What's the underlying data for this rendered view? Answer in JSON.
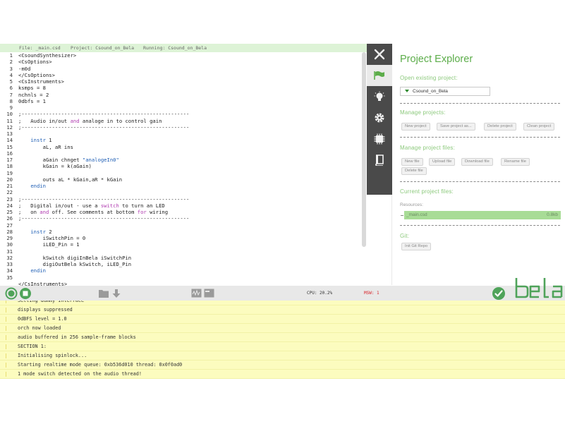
{
  "header": {
    "file": "File: _main.csd",
    "project": "Project: Csound_on_Bela",
    "running": "Running: Csound_on_Bela"
  },
  "editor": {
    "line_numbers": [
      "1",
      "2",
      "3",
      "4",
      "5",
      "6",
      "7",
      "8",
      "9",
      "10",
      "11",
      "12",
      "13",
      "14",
      "15",
      "16",
      "17",
      "18",
      "19",
      "20",
      "21",
      "22",
      "23",
      "24",
      "25",
      "26",
      "27",
      "28",
      "29",
      "30",
      "31",
      "32",
      "33",
      "34",
      "35"
    ],
    "lines": [
      "<CsoundSynthesizer>",
      "<CsOptions>",
      "-m0d",
      "</CsOptions>",
      "<CsInstruments>",
      "ksmps = 8",
      "nchnls = 2",
      "0dbfs = 1",
      "",
      ";-------------------------------------------------------",
      ";   Audio in/out and analoge in to control gain",
      ";-------------------------------------------------------",
      "",
      "    instr 1",
      "        aL, aR ins",
      "",
      "        aGain chnget \"analogeIn0\"",
      "        kGain = k(aGain)",
      "",
      "        outs aL * kGain,aR * kGain",
      "    endin",
      "",
      ";-------------------------------------------------------",
      ";   Digital in/out - use a switch to turn an LED",
      ";   on and off. See comments at bottom for wiring",
      ";-------------------------------------------------------",
      "",
      "    instr 2",
      "        iSwitchPin = 0",
      "        iLED_Pin = 1",
      "",
      "        kSwitch digiInBela iSwitchPin",
      "        digiOutBela kSwitch, iLED_Pin",
      "    endin",
      "",
      "</CsInstruments>"
    ]
  },
  "sidebar": {
    "close_icon": "close-icon",
    "tabs": [
      "flag-icon",
      "bulb-icon",
      "gear-icon",
      "chip-icon",
      "book-icon"
    ]
  },
  "explorer": {
    "title": "Project Explorer",
    "open_heading": "Open existing project:",
    "selected_project": "Csound_on_Bela",
    "manage_projects_heading": "Manage projects:",
    "project_buttons": [
      "New project",
      "Save project as...",
      "Delete project",
      "Clean project"
    ],
    "manage_files_heading": "Manage project files:",
    "file_buttons": [
      "New file",
      "Upload file",
      "Download file",
      "Rename file",
      "Delete file"
    ],
    "current_files_heading": "Current project files:",
    "resources_label": "Resources:",
    "file_name": "_main.csd",
    "file_size": "0.8kb",
    "git_heading": "Git:",
    "git_button": "Init Git Repo"
  },
  "toolbar": {
    "cpu": "CPU: 20.2%",
    "msw": "MSW: 1",
    "logo": "bela"
  },
  "console": {
    "lines": [
      "Setting dummy interface",
      "displays suppressed",
      "0dBFS level = 1.0",
      "orch now loaded",
      "audio buffered in 256 sample-frame blocks",
      "SECTION 1:",
      "Initialising spinlock...",
      "Starting realtime mode queue: 0xb536d010 thread: 0x0f0ad0",
      "1 mode switch detected on the audio thread!"
    ]
  },
  "colors": {
    "accent_green": "#5cad4a",
    "console_bg": "#fcfcbf",
    "msw_red": "#d8252b",
    "sidebar_dark": "#4a4a4a"
  }
}
